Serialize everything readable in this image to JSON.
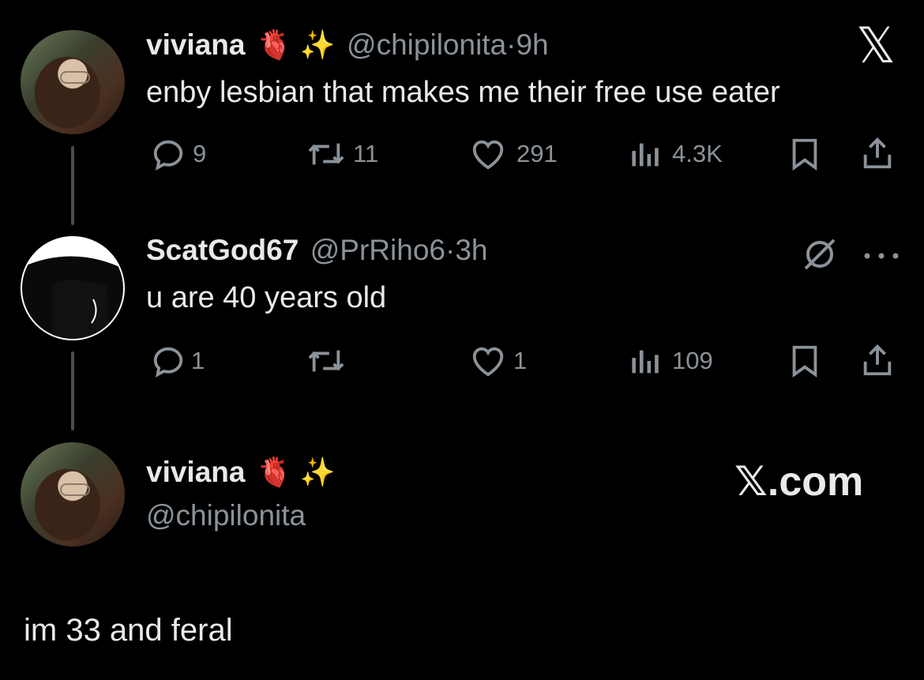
{
  "tweet1": {
    "name": "viviana",
    "emojis": "🫀 ✨",
    "handle": "@chipilonita",
    "dot": "·",
    "time": "9h",
    "text": "enby lesbian that makes me their free use eater",
    "replies": "9",
    "retweets": "11",
    "likes": "291",
    "views": "4.3K",
    "x_logo": "𝕏"
  },
  "tweet2": {
    "name": "ScatGod67",
    "handle": "@PrRiho6",
    "dot": "·",
    "time": "3h",
    "text": "u are 40 years old",
    "replies": "1",
    "retweets": "",
    "likes": "1",
    "views": "109"
  },
  "card": {
    "name": "viviana",
    "emojis": "🫀 ✨",
    "handle": "@chipilonita",
    "site": "𝕏.com",
    "text": "im 33 and feral"
  },
  "icons": {
    "reply": "reply-icon",
    "retweet": "retweet-icon",
    "like": "heart-icon",
    "views": "views-icon",
    "bookmark": "bookmark-icon",
    "share": "share-icon",
    "x_logo": "x-logo-icon",
    "grok": "grok-icon",
    "more": "more-icon"
  },
  "colors": {
    "background": "#000000",
    "text": "#e7e9ea",
    "muted": "#8b9299"
  }
}
